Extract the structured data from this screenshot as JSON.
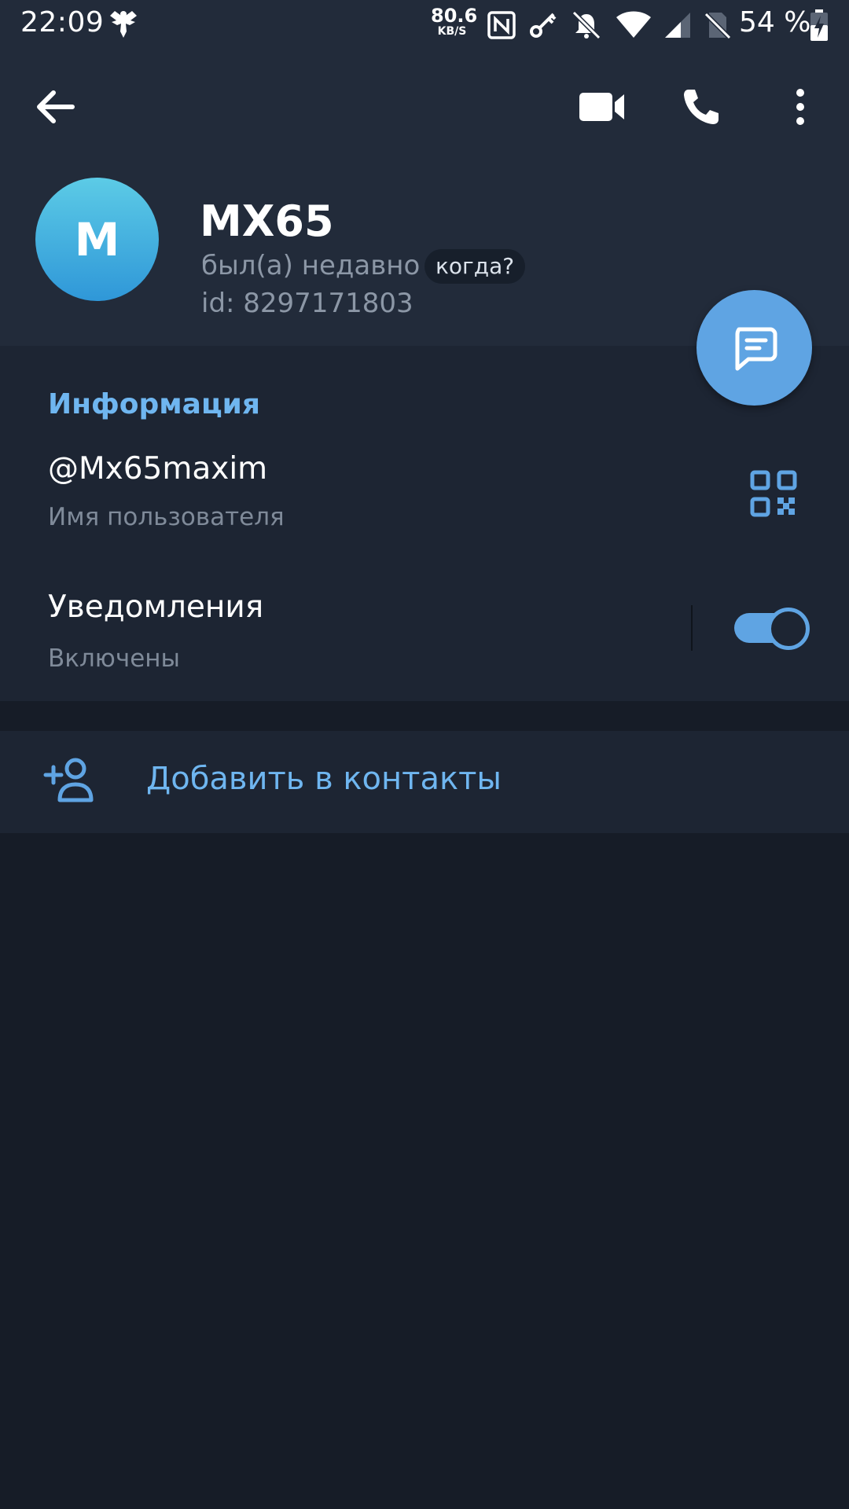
{
  "status_bar": {
    "time": "22:09",
    "net_speed_value": "80.6",
    "net_speed_unit": "KB/S",
    "battery_percent": "54 %",
    "icons": [
      "eagle-icon",
      "nfc-icon",
      "key-icon",
      "bell-off-icon",
      "wifi-icon",
      "signal-icon",
      "sim-off-icon",
      "battery-charging-icon"
    ]
  },
  "toolbar": {
    "icons": [
      "back-arrow-icon",
      "video-call-icon",
      "phone-icon",
      "more-vertical-icon"
    ]
  },
  "profile": {
    "avatar_letter": "M",
    "name": "MX65",
    "last_seen": "был(а) недавно",
    "when_chip": "когда?",
    "id_text": "id: 8297171803"
  },
  "info": {
    "section_title": "Информация",
    "username": "@Mx65maxim",
    "username_label": "Имя пользователя",
    "notifications_title": "Уведомления",
    "notifications_state": "Включены",
    "notifications_enabled": true
  },
  "actions": {
    "add_contact": "Добавить в контакты"
  },
  "colors": {
    "header_bg": "#222b3a",
    "section_bg": "#1d2533",
    "page_bg": "#161c27",
    "accent": "#5fa4e3",
    "accent_text": "#6fb6f0",
    "muted_text": "#8c97a6"
  }
}
